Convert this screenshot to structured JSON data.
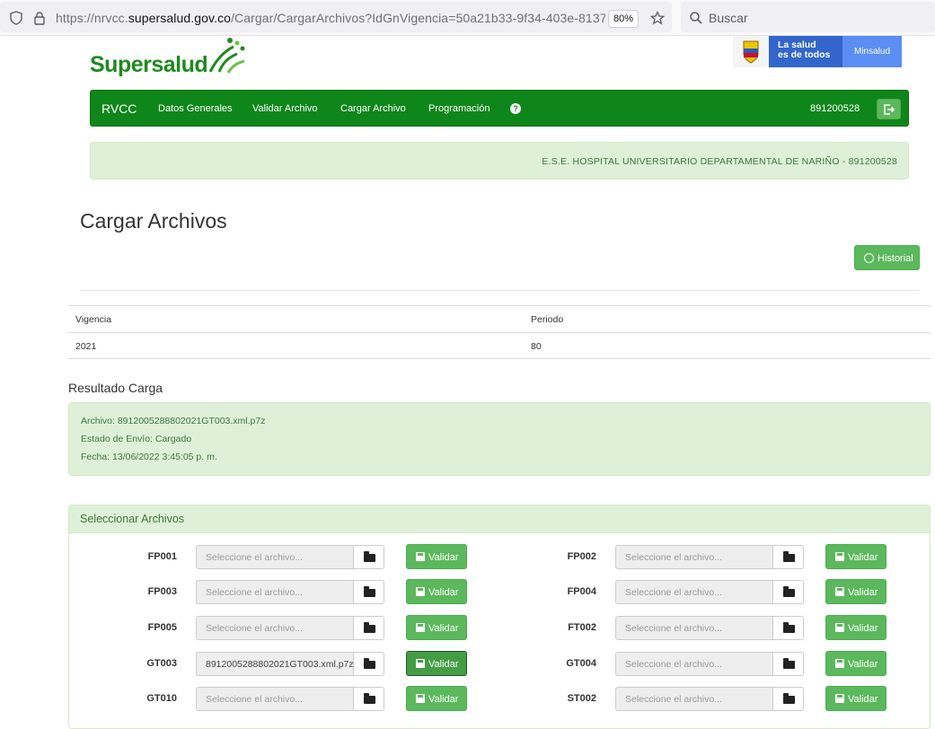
{
  "browser": {
    "url_prefix": "https://nrvcc.",
    "url_domain": "supersalud.gov.co",
    "url_path": "/Cargar/CargarArchivos?IdGnVigencia=50a21b33-9f34-403e-8137-",
    "zoom": "80%",
    "search_placeholder": "Buscar"
  },
  "header": {
    "logo_text": "Supersalud",
    "gov_slogan_line1": "La salud",
    "gov_slogan_line2": "es de todos",
    "gov_ministry": "Minsalud"
  },
  "navbar": {
    "brand": "RVCC",
    "items": [
      "Datos Generales",
      "Validar Archivo",
      "Cargar Archivo",
      "Programación"
    ],
    "help": "?",
    "nit": "891200528"
  },
  "entity": {
    "text": "E.S.E. HOSPITAL UNIVERSITARIO DEPARTAMENTAL DE NARIÑO - 891200528"
  },
  "page": {
    "title": "Cargar Archivos",
    "historial_label": "Historial"
  },
  "vigencia_table": {
    "headers": [
      "Vigencia",
      "Periodo"
    ],
    "row": [
      "2021",
      "80"
    ]
  },
  "result": {
    "section_title": "Resultado Carga",
    "archivo": "Archivo: 8912005288802021GT003.xml.p7z",
    "estado": "Estado de Envío: Cargado",
    "fecha": "Fecha: 13/06/2022 3:45:05 p. m."
  },
  "panel": {
    "title": "Seleccionar Archivos",
    "placeholder": "Seleccione el archivo...",
    "validar_label": "Validar",
    "files": [
      {
        "code": "FP001",
        "value": ""
      },
      {
        "code": "FP002",
        "value": ""
      },
      {
        "code": "FP003",
        "value": ""
      },
      {
        "code": "FP004",
        "value": ""
      },
      {
        "code": "FP005",
        "value": ""
      },
      {
        "code": "FT002",
        "value": ""
      },
      {
        "code": "GT003",
        "value": "8912005288802021GT003.xml.p7z"
      },
      {
        "code": "GT004",
        "value": ""
      },
      {
        "code": "GT010",
        "value": ""
      },
      {
        "code": "ST002",
        "value": ""
      }
    ]
  }
}
